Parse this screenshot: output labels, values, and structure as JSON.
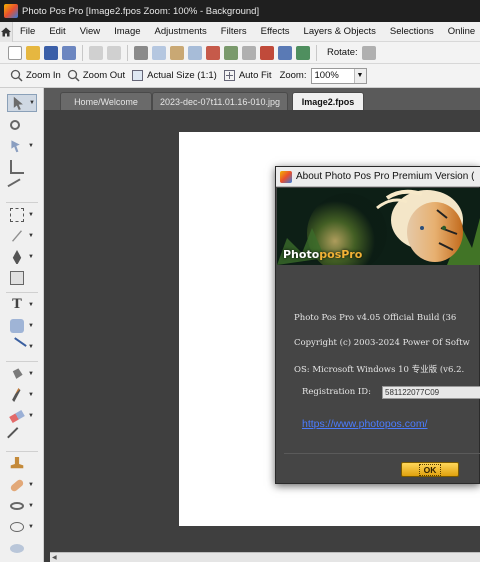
{
  "window": {
    "title": "Photo Pos Pro [Image2.fpos Zoom: 100% - Background]"
  },
  "menubar": {
    "items": [
      "File",
      "Edit",
      "View",
      "Image",
      "Adjustments",
      "Filters",
      "Effects",
      "Layers & Objects",
      "Selections",
      "Online"
    ]
  },
  "toolbar1": {
    "rotate_label": "Rotate:"
  },
  "toolbar2": {
    "zoom_in": "Zoom In",
    "zoom_out": "Zoom Out",
    "actual_size": "Actual Size (1:1)",
    "auto_fit": "Auto Fit",
    "zoom_label": "Zoom:",
    "zoom_value": "100%"
  },
  "tabs": [
    {
      "label": "Home/Welcome"
    },
    {
      "label": "2023-dec-07t11.01.16-010.jpg"
    },
    {
      "label": "Image2.fpos"
    }
  ],
  "dialog": {
    "title": "About Photo Pos Pro Premium Version (",
    "logo_part1": "Photo",
    "logo_part2": "posPro",
    "build_line": "Photo Pos Pro v4.05 Official Build (36",
    "copyright_line": "Copyright (c) 2003-2024 Power Of Softw",
    "os_line": "OS: Microsoft Windows 10 专业版 (v6.2.",
    "reg_label": "Registration ID:",
    "reg_value": "581122077C09",
    "link": "https://www.photopos.com/",
    "ok_label": "OK"
  },
  "colors": {
    "titlebar": "#1f1f1f",
    "workspace": "#3f3f3f",
    "dialog_bg": "#454545",
    "link": "#4b7cff",
    "ok_button": "#f2b92a"
  }
}
